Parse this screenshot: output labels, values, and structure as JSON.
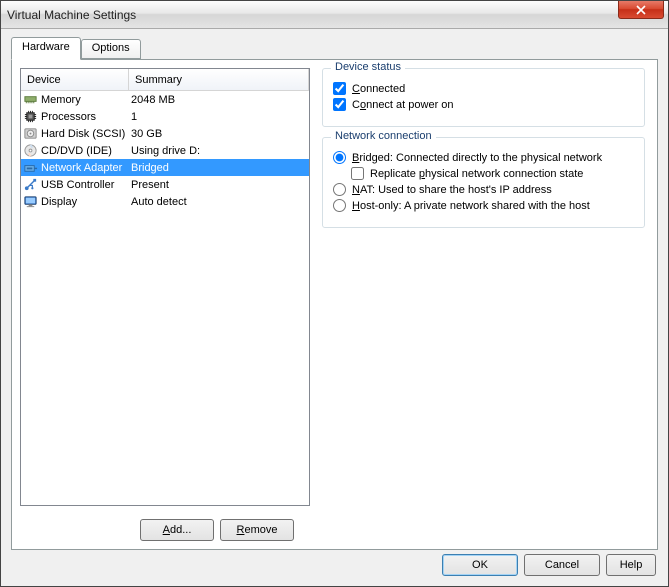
{
  "window": {
    "title": "Virtual Machine Settings"
  },
  "tabs": {
    "hardware": "Hardware",
    "options": "Options"
  },
  "table": {
    "headers": {
      "device": "Device",
      "summary": "Summary"
    },
    "rows": [
      {
        "icon": "memory",
        "device": "Memory",
        "summary": "2048 MB"
      },
      {
        "icon": "cpu",
        "device": "Processors",
        "summary": "1"
      },
      {
        "icon": "disk",
        "device": "Hard Disk (SCSI)",
        "summary": "30 GB"
      },
      {
        "icon": "cd",
        "device": "CD/DVD (IDE)",
        "summary": "Using drive D:"
      },
      {
        "icon": "net",
        "device": "Network Adapter",
        "summary": "Bridged",
        "selected": true
      },
      {
        "icon": "usb",
        "device": "USB Controller",
        "summary": "Present"
      },
      {
        "icon": "display",
        "device": "Display",
        "summary": "Auto detect"
      }
    ]
  },
  "device_status": {
    "legend": "Device status",
    "connected": "Connected",
    "connect_power": "Connect at power on"
  },
  "network_connection": {
    "legend": "Network connection",
    "bridged": "Bridged: Connected directly to the physical network",
    "replicate": "Replicate physical network connection state",
    "nat": "NAT: Used to share the host's IP address",
    "hostonly": "Host-only: A private network shared with the host"
  },
  "buttons": {
    "add": "Add...",
    "remove": "Remove",
    "ok": "OK",
    "cancel": "Cancel",
    "help": "Help"
  }
}
